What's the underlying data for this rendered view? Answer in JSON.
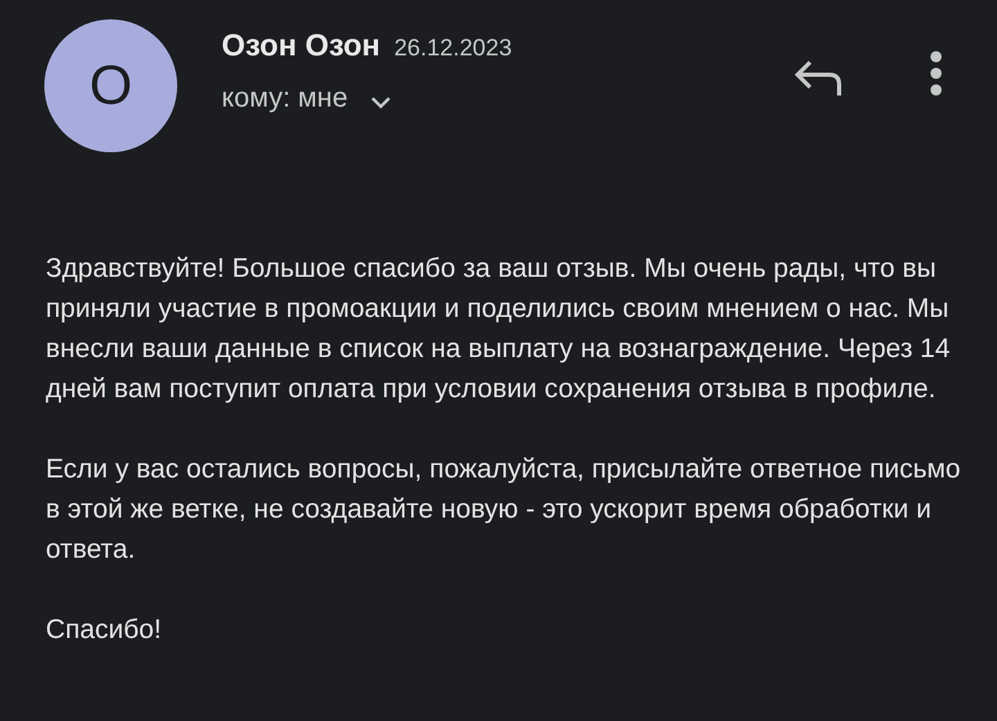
{
  "sender": {
    "avatar_letter": "О",
    "name": "Озон Озон",
    "date": "26.12.2023",
    "recipient": "кому: мне"
  },
  "body": [
    "Здравствуйте! Большое спасибо за ваш отзыв. Мы очень рады, что вы приняли участие в промоакции и поделились своим мнением о нас. Мы внесли ваши данные в список на выплату на вознаграждение. Через 14 дней вам поступит оплата при условии сохранения отзыва в профиле.",
    "Если у вас остались вопросы, пожалуйста, присылайте ответное письмо в этой же ветке, не создавайте новую - это ускорит время обработки и ответа.",
    "Спасибо!"
  ]
}
